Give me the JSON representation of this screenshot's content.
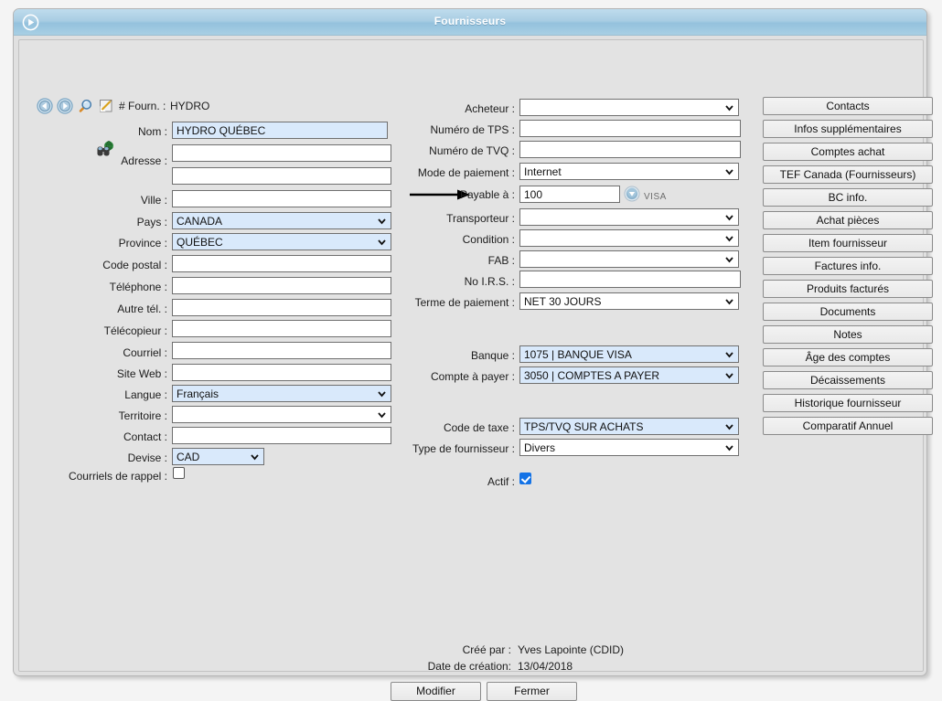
{
  "window": {
    "title": "Fournisseurs",
    "icon": "circled-play-icon"
  },
  "toolbar": {
    "back_icon": "back-arrow-icon",
    "forward_icon": "forward-arrow-icon",
    "search_icon": "magnifier-icon",
    "edit_icon": "pencil-note-icon",
    "fourn_label": "# Fourn. :",
    "fourn_value": "HYDRO"
  },
  "left_panel": {
    "address_lookup_icon": "binoculars-globe-icon",
    "fields": [
      {
        "label": "Nom :",
        "value": "HYDRO QUÉBEC",
        "type": "text",
        "highlight": true
      },
      {
        "label": "Adresse :",
        "value": "",
        "type": "text",
        "highlight": false
      },
      {
        "label": "",
        "value": "",
        "type": "text",
        "highlight": false
      },
      {
        "label": "Ville :",
        "value": "",
        "type": "text",
        "highlight": false
      },
      {
        "label": "Pays :",
        "value": "CANADA",
        "type": "select",
        "highlight": true
      },
      {
        "label": "Province :",
        "value": "QUÉBEC",
        "type": "select",
        "highlight": true
      },
      {
        "label": "Code postal :",
        "value": "",
        "type": "text",
        "highlight": false
      },
      {
        "label": "Téléphone :",
        "value": "",
        "type": "text",
        "highlight": false
      },
      {
        "label": "Autre tél. :",
        "value": "",
        "type": "text",
        "highlight": false
      },
      {
        "label": "Télécopieur :",
        "value": "",
        "type": "text",
        "highlight": false
      },
      {
        "label": "Courriel :",
        "value": "",
        "type": "text",
        "highlight": false
      },
      {
        "label": "Site Web :",
        "value": "",
        "type": "text",
        "highlight": false
      },
      {
        "label": "Langue :",
        "value": "Français",
        "type": "select",
        "highlight": true
      },
      {
        "label": "Territoire :",
        "value": "",
        "type": "select",
        "highlight": false
      },
      {
        "label": "Contact :",
        "value": "",
        "type": "text",
        "highlight": false
      },
      {
        "label": "Devise :",
        "value": "CAD",
        "type": "select",
        "highlight": true
      },
      {
        "label": "Courriels de rappel  :",
        "value": false,
        "type": "checkbox",
        "highlight": false
      }
    ]
  },
  "middle_panel": {
    "payable_arrow_icon": "right-arrow-annotation-icon",
    "visa_dropdown_icon": "blue-circle-chevron-icon",
    "visa_label": "VISA",
    "fields": [
      {
        "label": "Acheteur :",
        "value": "",
        "type": "select",
        "highlight": false
      },
      {
        "label": "Numéro de TPS :",
        "value": "",
        "type": "text",
        "highlight": false
      },
      {
        "label": "Numéro de TVQ :",
        "value": "",
        "type": "text",
        "highlight": false
      },
      {
        "label": "Mode de paiement :",
        "value": "Internet",
        "type": "select",
        "highlight": false
      },
      {
        "label": "Payable à :",
        "value": "100",
        "type": "text",
        "highlight": false
      },
      {
        "label": "Transporteur :",
        "value": "",
        "type": "select",
        "highlight": false
      },
      {
        "label": "Condition :",
        "value": "",
        "type": "select",
        "highlight": false
      },
      {
        "label": "FAB :",
        "value": "",
        "type": "select",
        "highlight": false
      },
      {
        "label": "No I.R.S. :",
        "value": "",
        "type": "text",
        "highlight": false
      },
      {
        "label": "Terme de paiement :",
        "value": "NET 30 JOURS",
        "type": "select",
        "highlight": false
      },
      {
        "label": "Banque :",
        "value": "1075 | BANQUE VISA",
        "type": "select",
        "highlight": true
      },
      {
        "label": "Compte à payer :",
        "value": "3050 | COMPTES A PAYER",
        "type": "select",
        "highlight": true
      },
      {
        "label": "Code de taxe :",
        "value": "TPS/TVQ SUR ACHATS",
        "type": "select",
        "highlight": true
      },
      {
        "label": "Type de fournisseur :",
        "value": "Divers",
        "type": "select",
        "highlight": false
      },
      {
        "label": "Actif  :",
        "value": true,
        "type": "checkbox",
        "highlight": false
      }
    ]
  },
  "side_buttons": [
    "Contacts",
    "Infos supplémentaires",
    "Comptes achat",
    "TEF Canada (Fournisseurs)",
    "BC info.",
    "Achat pièces",
    "Item fournisseur",
    "Factures info.",
    "Produits facturés",
    "Documents",
    "Notes",
    "Âge des comptes",
    "Décaissements",
    "Historique fournisseur",
    "Comparatif Annuel"
  ],
  "footer": {
    "created_by_label": "Créé par :",
    "created_by_value": "Yves Lapointe (CDID)",
    "created_date_label": "Date de création:",
    "created_date_value": "13/04/2018",
    "modify_button": "Modifier",
    "close_button": "Fermer"
  },
  "colors": {
    "title_bar": "#a9cde3",
    "highlight_field": "#d9e9fb",
    "checkbox_checked": "#1473e6",
    "client_bg": "#e3e3e3"
  }
}
